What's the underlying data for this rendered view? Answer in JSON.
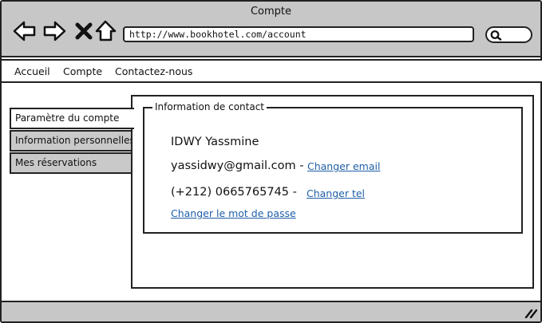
{
  "window": {
    "title": "Compte"
  },
  "toolbar": {
    "url": "http://www.bookhotel.com/account",
    "icons": [
      "back-icon",
      "forward-icon",
      "close-icon",
      "home-icon",
      "search-icon"
    ]
  },
  "menu": {
    "items": [
      {
        "label": "Accueil"
      },
      {
        "label": "Compte"
      },
      {
        "label": "Contactez-nous"
      }
    ]
  },
  "tabs": [
    {
      "label": "Paramètre du compte",
      "active": true
    },
    {
      "label": "Information personnelles",
      "active": false
    },
    {
      "label": "Mes réservations",
      "active": false
    }
  ],
  "contact": {
    "legend": "Information de contact",
    "name": "IDWY Yassmine",
    "email": "yassidwy@gmail.com",
    "email_sep": " -",
    "change_email": "Changer email",
    "phone": "(+212) 0665765745",
    "phone_sep": " -",
    "change_phone": "Changer tel",
    "change_password": "Changer le mot de passe"
  },
  "colors": {
    "chrome": "#c7c7c7",
    "link": "#1f5fa8",
    "border": "#222222"
  }
}
